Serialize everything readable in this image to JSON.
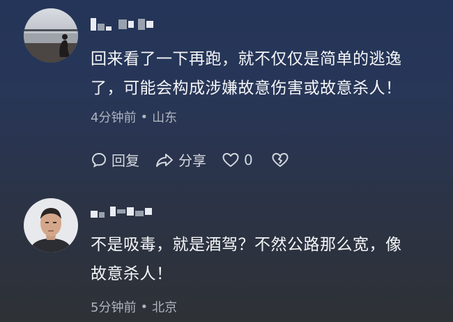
{
  "comments": [
    {
      "text": "回来看了一下再跑，就不仅仅是简单的逃逸\n了，可能会构成涉嫌故意伤害或故意杀人！",
      "time": "4分钟前",
      "location": "山东",
      "actions": {
        "reply_label": "回复",
        "share_label": "分享",
        "like_count": "0"
      },
      "icons": {
        "reply": "comment-bubble-icon",
        "share": "share-arrow-icon",
        "like": "heart-icon",
        "dislike": "broken-heart-icon"
      }
    },
    {
      "text": "不是吸毒，就是酒驾？不然公路那么宽，像\n故意杀人！",
      "time": "5分钟前",
      "location": "北京"
    }
  ],
  "separator": "•"
}
